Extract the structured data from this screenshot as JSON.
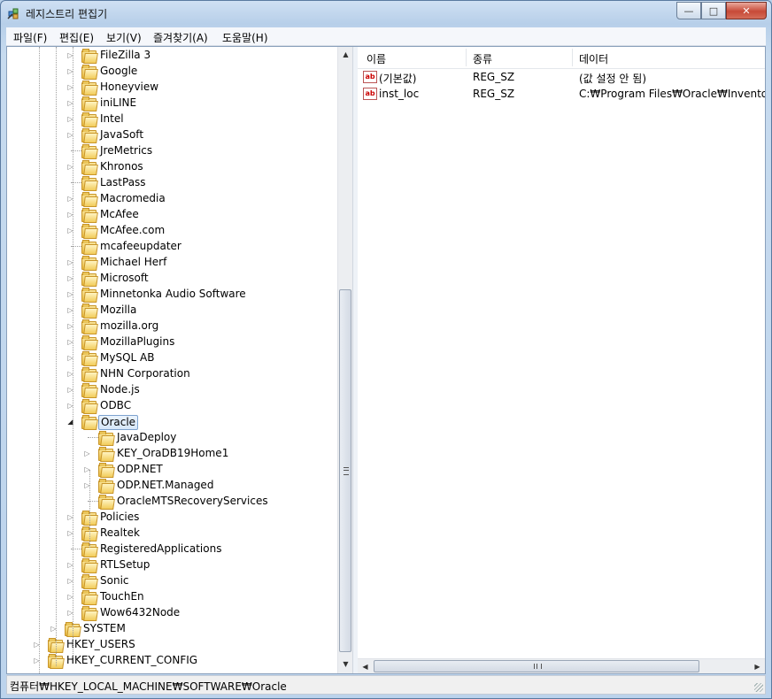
{
  "window": {
    "title": "레지스트리 편집기",
    "minimize": "—",
    "maximize": "□",
    "close": "✕"
  },
  "menu": [
    "파일(F)",
    "편집(E)",
    "보기(V)",
    "즐겨찾기(A)",
    "도움말(H)"
  ],
  "tree": [
    {
      "label": "FileZilla 3",
      "expandable": true
    },
    {
      "label": "Google",
      "expandable": true
    },
    {
      "label": "Honeyview",
      "expandable": true
    },
    {
      "label": "iniLINE",
      "expandable": true
    },
    {
      "label": "Intel",
      "expandable": true
    },
    {
      "label": "JavaSoft",
      "expandable": true
    },
    {
      "label": "JreMetrics",
      "expandable": false
    },
    {
      "label": "Khronos",
      "expandable": true
    },
    {
      "label": "LastPass",
      "expandable": false
    },
    {
      "label": "Macromedia",
      "expandable": true
    },
    {
      "label": "McAfee",
      "expandable": true
    },
    {
      "label": "McAfee.com",
      "expandable": true
    },
    {
      "label": "mcafeeupdater",
      "expandable": false
    },
    {
      "label": "Michael Herf",
      "expandable": true
    },
    {
      "label": "Microsoft",
      "expandable": true
    },
    {
      "label": "Minnetonka Audio Software",
      "expandable": true
    },
    {
      "label": "Mozilla",
      "expandable": true
    },
    {
      "label": "mozilla.org",
      "expandable": true
    },
    {
      "label": "MozillaPlugins",
      "expandable": true
    },
    {
      "label": "MySQL AB",
      "expandable": true
    },
    {
      "label": "NHN Corporation",
      "expandable": true
    },
    {
      "label": "Node.js",
      "expandable": true
    },
    {
      "label": "ODBC",
      "expandable": true
    },
    {
      "label": "Oracle",
      "expandable": true,
      "expanded": true,
      "selected": true
    },
    {
      "label": "JavaDeploy",
      "expandable": false,
      "child": true
    },
    {
      "label": "KEY_OraDB19Home1",
      "expandable": true,
      "child": true
    },
    {
      "label": "ODP.NET",
      "expandable": true,
      "child": true
    },
    {
      "label": "ODP.NET.Managed",
      "expandable": true,
      "child": true
    },
    {
      "label": "OracleMTSRecoveryServices",
      "expandable": false,
      "child": true
    },
    {
      "label": "Policies",
      "expandable": true
    },
    {
      "label": "Realtek",
      "expandable": true
    },
    {
      "label": "RegisteredApplications",
      "expandable": false
    },
    {
      "label": "RTLSetup",
      "expandable": true
    },
    {
      "label": "Sonic",
      "expandable": true
    },
    {
      "label": "TouchEn",
      "expandable": true
    },
    {
      "label": "Wow6432Node",
      "expandable": true
    },
    {
      "label": "SYSTEM",
      "expandable": true,
      "level": "hive-child"
    },
    {
      "label": "HKEY_USERS",
      "expandable": true,
      "level": "root"
    },
    {
      "label": "HKEY_CURRENT_CONFIG",
      "expandable": true,
      "level": "root"
    }
  ],
  "list": {
    "columns": [
      "이름",
      "종류",
      "데이터"
    ],
    "rows": [
      {
        "icon": "ab",
        "name": "(기본값)",
        "type": "REG_SZ",
        "data": "(값 설정 안 됨)"
      },
      {
        "icon": "ab",
        "name": "inst_loc",
        "type": "REG_SZ",
        "data": "C:₩Program Files₩Oracle₩Inventory"
      }
    ]
  },
  "status": {
    "path": "컴퓨터₩HKEY_LOCAL_MACHINE₩SOFTWARE₩Oracle"
  },
  "scroll": {
    "up": "▲",
    "down": "▼",
    "left": "◀",
    "right": "▶"
  }
}
